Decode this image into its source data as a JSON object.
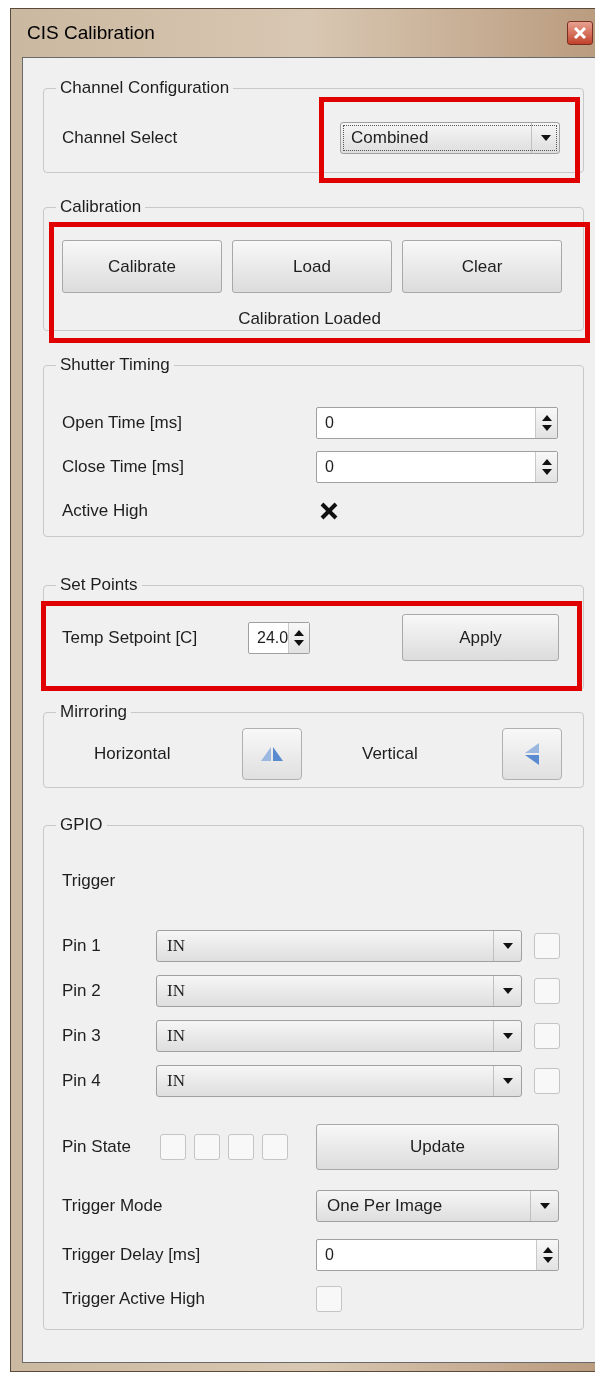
{
  "window": {
    "title": "CIS Calibration"
  },
  "channel_configuration": {
    "title": "Channel Configuration",
    "highlighted": true,
    "label": "Channel Select",
    "value": "Combined"
  },
  "calibration": {
    "title": "Calibration",
    "highlighted": true,
    "buttons": [
      "Calibrate",
      "Load",
      "Clear"
    ],
    "status": "Calibration Loaded"
  },
  "shutter_timing": {
    "title": "Shutter Timing",
    "fields": [
      {
        "label": "Open Time [ms]",
        "value": "0"
      },
      {
        "label": "Close Time [ms]",
        "value": "0"
      }
    ],
    "active_high": {
      "label": "Active High",
      "checked": true
    }
  },
  "set_points": {
    "title": "Set Points",
    "highlighted": true,
    "label": "Temp Setpoint [C]",
    "value": "24.0",
    "button": "Apply"
  },
  "mirroring": {
    "title": "Mirroring",
    "items": [
      {
        "label": "Horizontal",
        "kind": "horizontal"
      },
      {
        "label": "Vertical",
        "kind": "vertical"
      }
    ]
  },
  "gpio": {
    "title": "GPIO",
    "trigger_label": "Trigger",
    "pins": [
      {
        "label": "Pin 1",
        "value": "IN",
        "checked": false
      },
      {
        "label": "Pin 2",
        "value": "IN",
        "checked": false
      },
      {
        "label": "Pin 3",
        "value": "IN",
        "checked": false
      },
      {
        "label": "Pin 4",
        "value": "IN",
        "checked": false
      }
    ],
    "pin_state": {
      "label": "Pin State",
      "bits": [
        {
          "checked": false
        },
        {
          "checked": false
        },
        {
          "checked": false
        },
        {
          "checked": false
        }
      ]
    },
    "update_button": "Update",
    "trigger_mode": {
      "label": "Trigger Mode",
      "value": "One Per Image"
    },
    "trigger_delay": {
      "label": "Trigger Delay [ms]",
      "value": "0"
    },
    "trigger_active_high": {
      "label": "Trigger Active High",
      "checked": false
    }
  }
}
